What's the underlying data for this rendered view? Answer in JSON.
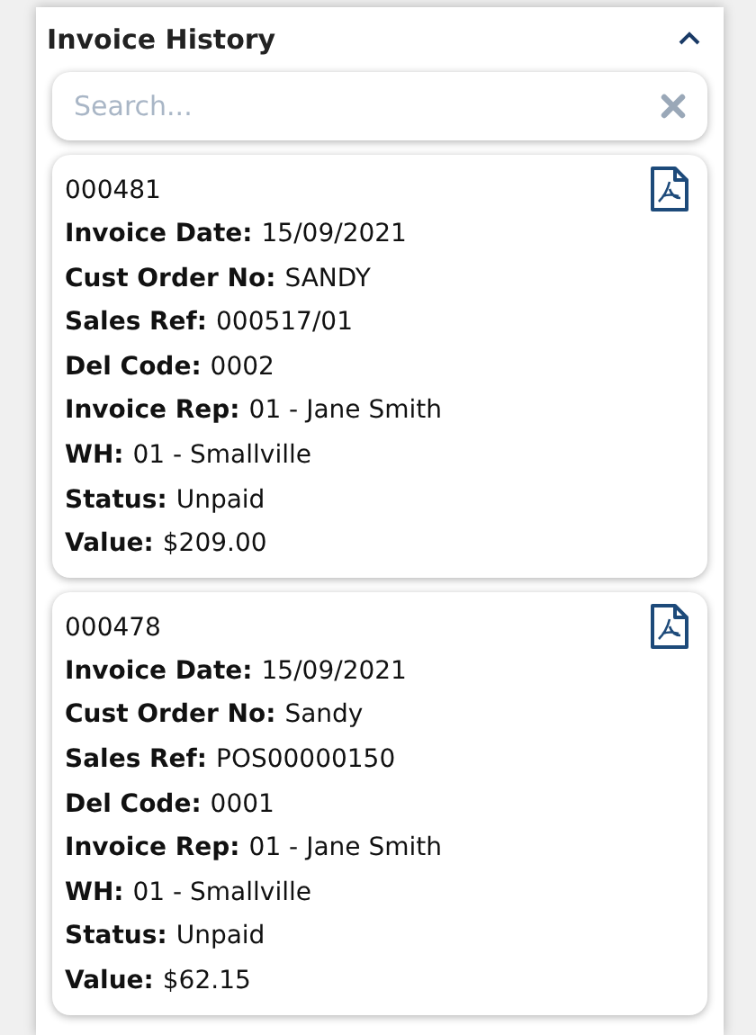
{
  "panel": {
    "title": "Invoice History",
    "expanded": true
  },
  "search": {
    "placeholder": "Search..."
  },
  "invoices": [
    {
      "number": "000481",
      "fields": [
        {
          "label": "Invoice Date:",
          "value": "15/09/2021"
        },
        {
          "label": "Cust Order No:",
          "value": "SANDY"
        },
        {
          "label": "Sales Ref:",
          "value": "000517/01"
        },
        {
          "label": "Del Code:",
          "value": "0002"
        },
        {
          "label": "Invoice Rep:",
          "value": "01 - Jane Smith"
        },
        {
          "label": "WH:",
          "value": "01 - Smallville"
        },
        {
          "label": "Status:",
          "value": "Unpaid"
        },
        {
          "label": "Value:",
          "value": "$209.00"
        }
      ]
    },
    {
      "number": "000478",
      "fields": [
        {
          "label": "Invoice Date:",
          "value": "15/09/2021"
        },
        {
          "label": "Cust Order No:",
          "value": "Sandy"
        },
        {
          "label": "Sales Ref:",
          "value": "POS00000150"
        },
        {
          "label": "Del Code:",
          "value": "0001"
        },
        {
          "label": "Invoice Rep:",
          "value": "01 - Jane Smith"
        },
        {
          "label": "WH:",
          "value": "01 - Smallville"
        },
        {
          "label": "Status:",
          "value": "Unpaid"
        },
        {
          "label": "Value:",
          "value": "$62.15"
        }
      ]
    }
  ]
}
